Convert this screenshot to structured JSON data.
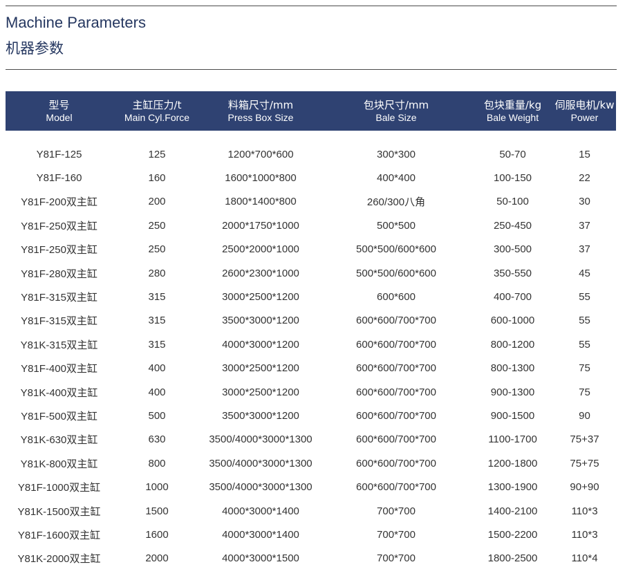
{
  "header": {
    "title_en": "Machine Parameters",
    "title_zh": "机器参数"
  },
  "table": {
    "columns": [
      {
        "zh": "型号",
        "en": "Model"
      },
      {
        "zh": "主缸压力/t",
        "en": "Main Cyl.Force"
      },
      {
        "zh": "料箱尺寸/mm",
        "en": "Press Box Size"
      },
      {
        "zh": "包块尺寸/mm",
        "en": "Bale Size"
      },
      {
        "zh": "包块重量/kg",
        "en": "Bale Weight"
      },
      {
        "zh": "伺服电机/kw",
        "en": "Power"
      }
    ],
    "rows": [
      [
        "Y81F-125",
        "125",
        "1200*700*600",
        "300*300",
        "50-70",
        "15"
      ],
      [
        "Y81F-160",
        "160",
        "1600*1000*800",
        "400*400",
        "100-150",
        "22"
      ],
      [
        "Y81F-200双主缸",
        "200",
        "1800*1400*800",
        "260/300八角",
        "50-100",
        "30"
      ],
      [
        "Y81F-250双主缸",
        "250",
        "2000*1750*1000",
        "500*500",
        "250-450",
        "37"
      ],
      [
        "Y81F-250双主缸",
        "250",
        "2500*2000*1000",
        "500*500/600*600",
        "300-500",
        "37"
      ],
      [
        "Y81F-280双主缸",
        "280",
        "2600*2300*1000",
        "500*500/600*600",
        "350-550",
        "45"
      ],
      [
        "Y81F-315双主缸",
        "315",
        "3000*2500*1200",
        "600*600",
        "400-700",
        "55"
      ],
      [
        "Y81F-315双主缸",
        "315",
        "3500*3000*1200",
        "600*600/700*700",
        "600-1000",
        "55"
      ],
      [
        "Y81K-315双主缸",
        "315",
        "4000*3000*1200",
        "600*600/700*700",
        "800-1200",
        "55"
      ],
      [
        "Y81F-400双主缸",
        "400",
        "3000*2500*1200",
        "600*600/700*700",
        "800-1300",
        "75"
      ],
      [
        "Y81K-400双主缸",
        "400",
        "3000*2500*1200",
        "600*600/700*700",
        "900-1300",
        "75"
      ],
      [
        "Y81F-500双主缸",
        "500",
        "3500*3000*1200",
        "600*600/700*700",
        "900-1500",
        "90"
      ],
      [
        "Y81K-630双主缸",
        "630",
        "3500/4000*3000*1300",
        "600*600/700*700",
        "1100-1700",
        "75+37"
      ],
      [
        "Y81K-800双主缸",
        "800",
        "3500/4000*3000*1300",
        "600*600/700*700",
        "1200-1800",
        "75+75"
      ],
      [
        "Y81F-1000双主缸",
        "1000",
        "3500/4000*3000*1300",
        "600*600/700*700",
        "1300-1900",
        "90+90"
      ],
      [
        "Y81K-1500双主缸",
        "1500",
        "4000*3000*1400",
        "700*700",
        "1400-2100",
        "110*3"
      ],
      [
        "Y81F-1600双主缸",
        "1600",
        "4000*3000*1400",
        "700*700",
        "1500-2200",
        "110*3"
      ],
      [
        "Y81K-2000双主缸",
        "2000",
        "4000*3000*1500",
        "700*700",
        "1800-2500",
        "110*4"
      ]
    ]
  },
  "colors": {
    "header_bg": "#2f4272",
    "title": "#253760",
    "rule": "#4a4a4a"
  }
}
